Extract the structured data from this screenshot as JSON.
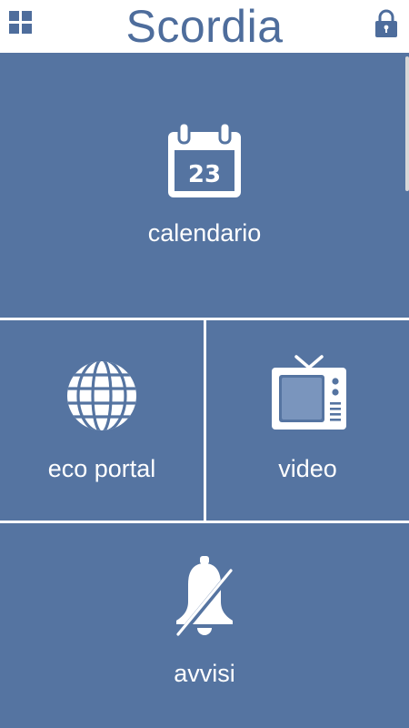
{
  "header": {
    "title": "Scordia",
    "menu_icon": "grid-icon",
    "lock_icon": "lock-icon"
  },
  "colors": {
    "brand": "#4e6d9c",
    "tile": "#5574a1",
    "divider": "#ffffff"
  },
  "tiles": {
    "calendario": {
      "label": "calendario",
      "icon": "calendar-icon",
      "day": "23"
    },
    "eco_portal": {
      "label": "eco portal",
      "icon": "globe-icon"
    },
    "video": {
      "label": "video",
      "icon": "tv-icon"
    },
    "avvisi": {
      "label": "avvisi",
      "icon": "bell-muted-icon"
    }
  }
}
